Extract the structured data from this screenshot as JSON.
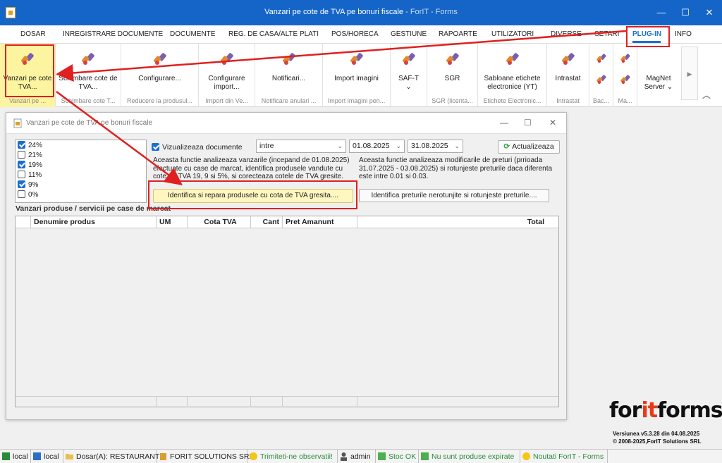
{
  "window": {
    "title": "Vanzari pe cote de TVA pe bonuri fiscale",
    "subtitle": " - ForIT - Forms",
    "minimize": "—",
    "maximize": "☐",
    "close": "✕"
  },
  "menu": {
    "items": [
      "DOSAR",
      "INREGISTRARE DOCUMENTE",
      "DOCUMENTE",
      "REG. DE CASA/ALTE PLATI",
      "POS/HORECA",
      "GESTIUNE",
      "RAPOARTE",
      "UTILIZATORI",
      "DIVERSE",
      "SETARI",
      "PLUG-IN",
      "INFO"
    ],
    "active": "PLUG-IN"
  },
  "ribbon": {
    "buttons": [
      {
        "label": "Vanzari pe cote TVA...",
        "group": "Vanzari pe ..."
      },
      {
        "label": "Schimbare cote de TVA...",
        "group": "Schimbare cote T..."
      },
      {
        "label": "Configurare...",
        "group": "Reducere la produsul..."
      },
      {
        "label": "Configurare import...",
        "group": "Import din Ve..."
      },
      {
        "label": "Notificari...",
        "group": "Notificare anulari ..."
      },
      {
        "label": "Import imagini",
        "group": "Import imagini pen..."
      },
      {
        "label": "SAF-T",
        "group": ""
      },
      {
        "label": "SGR",
        "group": "SGR (licenta..."
      },
      {
        "label": "Sabloane etichete electronice (YT)",
        "group": "Etichete Electronic..."
      },
      {
        "label": "Intrastat",
        "group": "Intrastat"
      },
      {
        "label": "",
        "group": "Bac..."
      },
      {
        "label": "",
        "group": "Ma..."
      },
      {
        "label": "MagNet Server",
        "group": ""
      }
    ],
    "chevron": "⌄",
    "scroll_right": "▶",
    "collapse": "︿"
  },
  "child": {
    "title": "Vanzari pe cote de TVA pe bonuri fiscale",
    "minimize": "—",
    "maximize": "☐",
    "close": "✕",
    "vat_rates": [
      {
        "label": "24%",
        "checked": true
      },
      {
        "label": "21%",
        "checked": false
      },
      {
        "label": "19%",
        "checked": true
      },
      {
        "label": "11%",
        "checked": false
      },
      {
        "label": "9%",
        "checked": true
      },
      {
        "label": "0%",
        "checked": false
      }
    ],
    "viz_label": "Vizualizeaza documente",
    "range_mode": "intre",
    "date_from": "01.08.2025",
    "date_to": "31.08.2025",
    "refresh_label": "Actualizeaza",
    "desc_left": "Aceasta functie analizeaza vanzarile (incepand de 01.08.2025) efectuate cu case de marcat, identifica produsele vandute cu cote de TVA 19, 9 si 5%, si corecteaza cotele de TVA gresite.",
    "desc_right": "Aceasta functie analizeaza modificarile de preturi (prrioada 31.07.2025 - 03.08.2025) si rotunjeste preturile daca diferenta este intre 0.01 si 0.03.",
    "fix_button": "Identifica si repara produsele cu cota de TVA gresita....",
    "round_button": "Identifica preturile nerotunjite si rotunjeste preturile....",
    "section_title": "Vanzari produse / servicii pe case de marcat",
    "columns": [
      "",
      "Denumire produs",
      "UM",
      "Cota TVA",
      "Cant",
      "Pret Amanunt",
      "Total"
    ]
  },
  "logo": {
    "part1": "for",
    "part2": "it",
    "part3": "forms",
    "version": "Versiunea v5.3.28 din 04.08.2025",
    "copyright": "© 2008-2025,ForIT Solutions SRL"
  },
  "statusbar": {
    "items": [
      "local",
      "local",
      "Dosar(A): RESTAURANT",
      "FORIT SOLUTIONS SRL",
      "Trimiteti-ne observatii!",
      "admin",
      "Stoc OK",
      "Nu sunt produse expirate",
      "Noutati ForIT - Forms"
    ]
  },
  "colors": {
    "titlebar": "#1565c8",
    "accent": "#1a6fd0",
    "highlight_button": "#fff6c0",
    "annotation": "#e02020"
  }
}
